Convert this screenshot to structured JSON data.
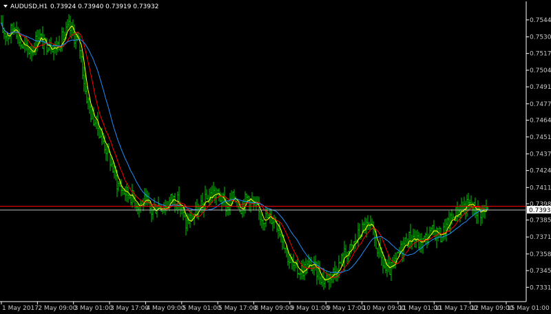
{
  "header": {
    "symbol": "AUDUSD,H1",
    "ohlc": "0.73924 0.73940 0.73919 0.73932"
  },
  "price_marker": {
    "label": "0.73932",
    "bg": "#ffffff",
    "fg": "#000000"
  },
  "colors": {
    "background": "#000000",
    "bars": "#00c800",
    "ma_fast": "#ffff00",
    "ma_mid": "#ff0000",
    "ma_slow": "#1e90ff",
    "bid_line": "#c0c0c0",
    "ask_line": "#ff0000",
    "axis": "#ffffff",
    "text": "#c8c8c8"
  },
  "chart_data": {
    "type": "ohlc",
    "instrument": "AUDUSD",
    "timeframe": "H1",
    "ylim": [
      0.7321,
      0.7559
    ],
    "y_ticks": [
      "0.75443",
      "0.75308",
      "0.75176",
      "0.75043",
      "0.74911",
      "0.74776",
      "0.74646",
      "0.74513",
      "0.74378",
      "0.74246",
      "0.74111",
      "0.73982",
      "0.73853",
      "0.73718",
      "0.73583",
      "0.73451",
      "0.73318"
    ],
    "x_labels": [
      "1 May 2017",
      "2 May 09:00",
      "3 May 01:00",
      "3 May 17:00",
      "4 May 09:00",
      "5 May 01:00",
      "5 May 17:00",
      "8 May 09:00",
      "9 May 01:00",
      "9 May 17:00",
      "10 May 09:00",
      "11 May 01:00",
      "11 May 17:00",
      "12 May 09:00",
      "15 May 01:00"
    ],
    "last_price": 0.73932,
    "ask_line": 0.73962,
    "close_path": [
      [
        0,
        0.7538
      ],
      [
        12,
        0.7532
      ],
      [
        22,
        0.7541
      ],
      [
        30,
        0.7525
      ],
      [
        40,
        0.752
      ],
      [
        48,
        0.7522
      ],
      [
        56,
        0.7533
      ],
      [
        64,
        0.7524
      ],
      [
        72,
        0.7527
      ],
      [
        80,
        0.7522
      ],
      [
        90,
        0.7529
      ],
      [
        100,
        0.7538
      ],
      [
        110,
        0.753
      ],
      [
        116,
        0.7522
      ],
      [
        124,
        0.7488
      ],
      [
        132,
        0.747
      ],
      [
        140,
        0.7462
      ],
      [
        150,
        0.7448
      ],
      [
        160,
        0.7433
      ],
      [
        170,
        0.7415
      ],
      [
        180,
        0.7408
      ],
      [
        190,
        0.7405
      ],
      [
        200,
        0.7398
      ],
      [
        210,
        0.74
      ],
      [
        220,
        0.7392
      ],
      [
        230,
        0.7398
      ],
      [
        240,
        0.7396
      ],
      [
        250,
        0.7403
      ],
      [
        260,
        0.7399
      ],
      [
        270,
        0.7382
      ],
      [
        280,
        0.7389
      ],
      [
        290,
        0.7393
      ],
      [
        300,
        0.7402
      ],
      [
        310,
        0.7407
      ],
      [
        320,
        0.7403
      ],
      [
        330,
        0.7395
      ],
      [
        340,
        0.7404
      ],
      [
        350,
        0.7396
      ],
      [
        360,
        0.7404
      ],
      [
        370,
        0.7395
      ],
      [
        380,
        0.7388
      ],
      [
        390,
        0.7387
      ],
      [
        400,
        0.7386
      ],
      [
        410,
        0.7372
      ],
      [
        420,
        0.7353
      ],
      [
        430,
        0.7345
      ],
      [
        440,
        0.7346
      ],
      [
        450,
        0.735
      ],
      [
        460,
        0.7345
      ],
      [
        470,
        0.7338
      ],
      [
        480,
        0.7342
      ],
      [
        490,
        0.7347
      ],
      [
        500,
        0.7358
      ],
      [
        510,
        0.7362
      ],
      [
        520,
        0.7373
      ],
      [
        530,
        0.7381
      ],
      [
        540,
        0.7376
      ],
      [
        550,
        0.736
      ],
      [
        560,
        0.7345
      ],
      [
        570,
        0.7346
      ],
      [
        580,
        0.736
      ],
      [
        590,
        0.737
      ],
      [
        600,
        0.7372
      ],
      [
        610,
        0.7366
      ],
      [
        620,
        0.7372
      ],
      [
        630,
        0.7376
      ],
      [
        640,
        0.7373
      ],
      [
        650,
        0.7381
      ],
      [
        660,
        0.739
      ],
      [
        670,
        0.7395
      ],
      [
        680,
        0.7397
      ],
      [
        690,
        0.7394
      ],
      [
        700,
        0.7392
      ],
      [
        708,
        0.7393
      ]
    ]
  }
}
